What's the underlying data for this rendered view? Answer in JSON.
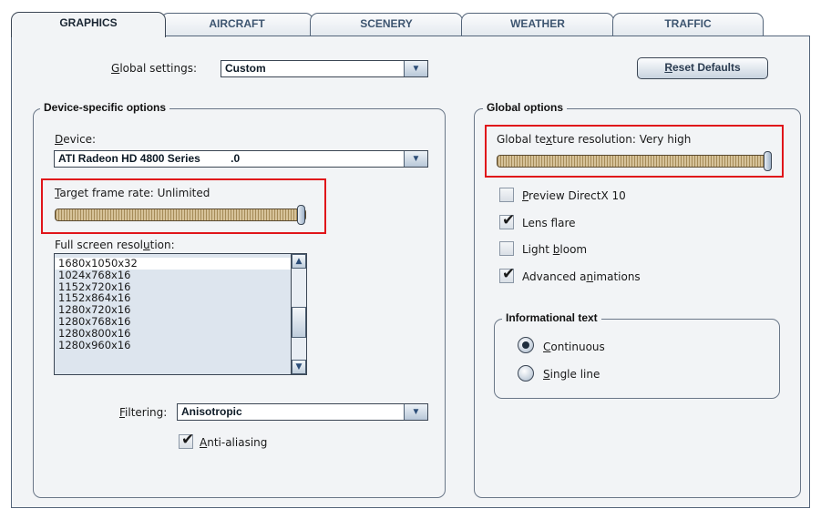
{
  "tabs": [
    {
      "label": "GRAPHICS",
      "active": true
    },
    {
      "label": "AIRCRAFT",
      "active": false
    },
    {
      "label": "SCENERY",
      "active": false
    },
    {
      "label": "WEATHER",
      "active": false
    },
    {
      "label": "TRAFFIC",
      "active": false
    }
  ],
  "global_settings": {
    "label": "Global settings:",
    "value": "Custom"
  },
  "reset_button": {
    "label": "Reset Defaults"
  },
  "device_group": {
    "title": "Device-specific options",
    "device": {
      "label": "Device:",
      "value": "ATI Radeon HD 4800 Series          .0"
    },
    "frame_rate": {
      "label": "Target frame rate: Unlimited",
      "slider_value": 1.0
    },
    "resolution": {
      "label": "Full screen resolution:",
      "items": [
        "1680x1050x32",
        "1024x768x16",
        "1152x720x16",
        "1152x864x16",
        "1280x720x16",
        "1280x768x16",
        "1280x800x16",
        "1280x960x16"
      ],
      "selected": "1680x1050x32"
    },
    "filtering": {
      "label": "Filtering:",
      "value": "Anisotropic"
    },
    "anti_aliasing": {
      "label": "Anti-aliasing",
      "checked": true
    }
  },
  "global_group": {
    "title": "Global options",
    "texture": {
      "label": "Global texture resolution: Very high",
      "slider_value": 1.0
    },
    "checkboxes": [
      {
        "label": "Preview DirectX 10",
        "checked": false
      },
      {
        "label": "Lens flare",
        "checked": true
      },
      {
        "label": "Light bloom",
        "checked": false
      },
      {
        "label": "Advanced animations",
        "checked": true
      }
    ],
    "info_text": {
      "title": "Informational text",
      "options": [
        {
          "label": "Continuous",
          "selected": true
        },
        {
          "label": "Single line",
          "selected": false
        }
      ]
    }
  },
  "colors": {
    "highlight": "#e0151a",
    "panel": "#f2f4f6",
    "slider": "#d6c299"
  }
}
